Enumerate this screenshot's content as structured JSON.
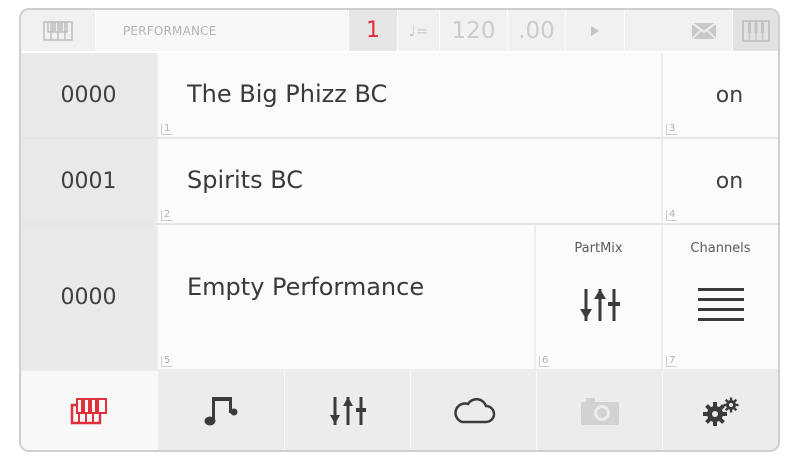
{
  "header": {
    "title": "PERFORMANCE",
    "part_number": "1",
    "note_symbol": "♩=",
    "tempo": "120",
    "tempo_fraction": ".00"
  },
  "rows": [
    {
      "number": "0000",
      "name": "The Big Phizz BC",
      "index": "1",
      "state": "on",
      "state_index": "3"
    },
    {
      "number": "0001",
      "name": "Spirits BC",
      "index": "2",
      "state": "on",
      "state_index": "4"
    },
    {
      "number": "0000",
      "name": "Empty Performance",
      "index": "5"
    }
  ],
  "partmix": {
    "title": "PartMix",
    "index": "6"
  },
  "channels": {
    "title": "Channels",
    "index": "7"
  },
  "toolbar": {
    "items": [
      {
        "icon": "keyboard-icon",
        "active": true
      },
      {
        "icon": "music-note-icon"
      },
      {
        "icon": "mixer-sliders-icon"
      },
      {
        "icon": "cloud-icon"
      },
      {
        "icon": "camera-icon"
      },
      {
        "icon": "settings-gears-icon"
      }
    ]
  },
  "colors": {
    "accent": "#e0313a",
    "icon": "#3b3b3b",
    "muted": "#c8c8c8"
  }
}
